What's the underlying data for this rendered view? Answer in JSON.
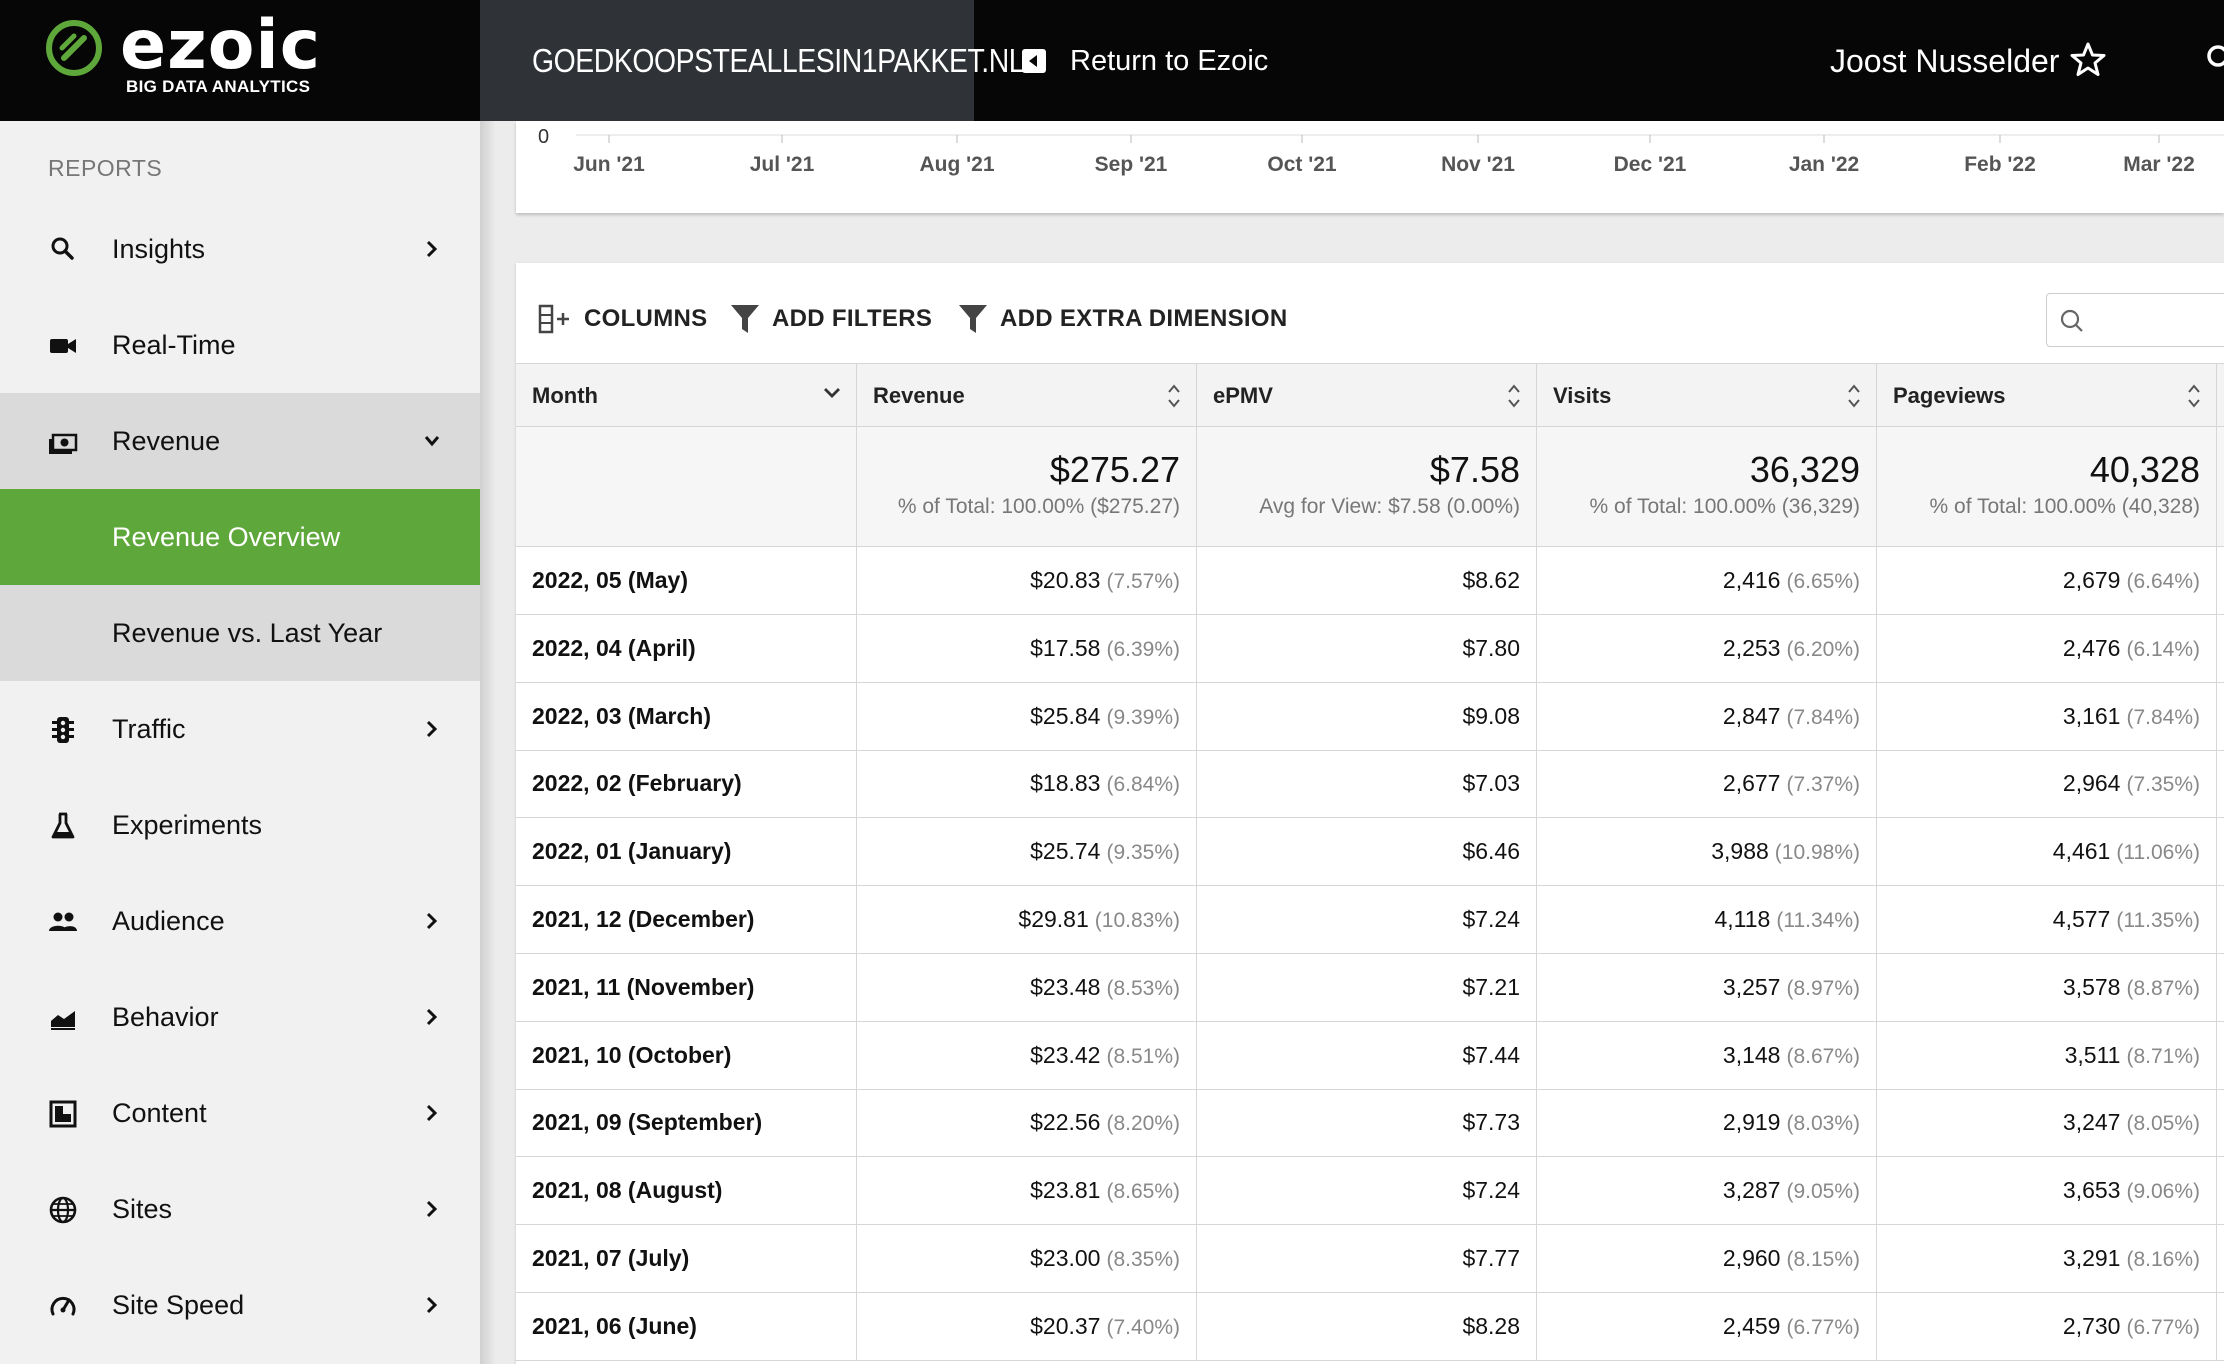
{
  "header": {
    "logo_text": "ezoic",
    "logo_sub": "BIG DATA ANALYTICS",
    "site_name": "GOEDKOOPSTEALLESIN1PAKKET.NL",
    "return_label": "Return to Ezoic",
    "user_name": "Joost Nusselder"
  },
  "sidebar": {
    "title": "REPORTS",
    "items": [
      {
        "label": "Insights",
        "icon": "search-icon"
      },
      {
        "label": "Real-Time",
        "icon": "video-camera-icon"
      },
      {
        "label": "Revenue",
        "icon": "money-icon"
      },
      {
        "label": "Revenue Overview"
      },
      {
        "label": "Revenue vs. Last Year"
      },
      {
        "label": "Traffic",
        "icon": "traffic-light-icon"
      },
      {
        "label": "Experiments",
        "icon": "flask-icon"
      },
      {
        "label": "Audience",
        "icon": "people-icon"
      },
      {
        "label": "Behavior",
        "icon": "area-chart-icon"
      },
      {
        "label": "Content",
        "icon": "content-layout-icon"
      },
      {
        "label": "Sites",
        "icon": "globe-icon"
      },
      {
        "label": "Site Speed",
        "icon": "speedometer-icon"
      }
    ]
  },
  "chart": {
    "y_zero": "0",
    "x_labels": [
      "Jun '21",
      "Jul '21",
      "Aug '21",
      "Sep '21",
      "Oct '21",
      "Nov '21",
      "Dec '21",
      "Jan '22",
      "Feb '22",
      "Mar '22"
    ]
  },
  "toolbar": {
    "columns_label": "COLUMNS",
    "filters_label": "ADD FILTERS",
    "dimension_label": "ADD EXTRA DIMENSION"
  },
  "table": {
    "headers": [
      "Month",
      "Revenue",
      "ePMV",
      "Visits",
      "Pageviews"
    ],
    "totals": {
      "revenue": {
        "value": "$275.27",
        "note": "% of Total: 100.00%  ($275.27)"
      },
      "epmv": {
        "value": "$7.58",
        "note": "Avg for View: $7.58  (0.00%)"
      },
      "visits": {
        "value": "36,329",
        "note": "% of Total: 100.00%  (36,329)"
      },
      "pageviews": {
        "value": "40,328",
        "note": "% of Total: 100.00%  (40,328)"
      }
    },
    "rows": [
      {
        "month": "2022, 05 (May)",
        "revenue": "$20.83",
        "revenue_pct": "(7.57%)",
        "epmv": "$8.62",
        "visits": "2,416",
        "visits_pct": "(6.65%)",
        "pageviews": "2,679",
        "pageviews_pct": "(6.64%)"
      },
      {
        "month": "2022, 04 (April)",
        "revenue": "$17.58",
        "revenue_pct": "(6.39%)",
        "epmv": "$7.80",
        "visits": "2,253",
        "visits_pct": "(6.20%)",
        "pageviews": "2,476",
        "pageviews_pct": "(6.14%)"
      },
      {
        "month": "2022, 03 (March)",
        "revenue": "$25.84",
        "revenue_pct": "(9.39%)",
        "epmv": "$9.08",
        "visits": "2,847",
        "visits_pct": "(7.84%)",
        "pageviews": "3,161",
        "pageviews_pct": "(7.84%)"
      },
      {
        "month": "2022, 02 (February)",
        "revenue": "$18.83",
        "revenue_pct": "(6.84%)",
        "epmv": "$7.03",
        "visits": "2,677",
        "visits_pct": "(7.37%)",
        "pageviews": "2,964",
        "pageviews_pct": "(7.35%)"
      },
      {
        "month": "2022, 01 (January)",
        "revenue": "$25.74",
        "revenue_pct": "(9.35%)",
        "epmv": "$6.46",
        "visits": "3,988",
        "visits_pct": "(10.98%)",
        "pageviews": "4,461",
        "pageviews_pct": "(11.06%)"
      },
      {
        "month": "2021, 12 (December)",
        "revenue": "$29.81",
        "revenue_pct": "(10.83%)",
        "epmv": "$7.24",
        "visits": "4,118",
        "visits_pct": "(11.34%)",
        "pageviews": "4,577",
        "pageviews_pct": "(11.35%)"
      },
      {
        "month": "2021, 11 (November)",
        "revenue": "$23.48",
        "revenue_pct": "(8.53%)",
        "epmv": "$7.21",
        "visits": "3,257",
        "visits_pct": "(8.97%)",
        "pageviews": "3,578",
        "pageviews_pct": "(8.87%)"
      },
      {
        "month": "2021, 10 (October)",
        "revenue": "$23.42",
        "revenue_pct": "(8.51%)",
        "epmv": "$7.44",
        "visits": "3,148",
        "visits_pct": "(8.67%)",
        "pageviews": "3,511",
        "pageviews_pct": "(8.71%)"
      },
      {
        "month": "2021, 09 (September)",
        "revenue": "$22.56",
        "revenue_pct": "(8.20%)",
        "epmv": "$7.73",
        "visits": "2,919",
        "visits_pct": "(8.03%)",
        "pageviews": "3,247",
        "pageviews_pct": "(8.05%)"
      },
      {
        "month": "2021, 08 (August)",
        "revenue": "$23.81",
        "revenue_pct": "(8.65%)",
        "epmv": "$7.24",
        "visits": "3,287",
        "visits_pct": "(9.05%)",
        "pageviews": "3,653",
        "pageviews_pct": "(9.06%)"
      },
      {
        "month": "2021, 07 (July)",
        "revenue": "$23.00",
        "revenue_pct": "(8.35%)",
        "epmv": "$7.77",
        "visits": "2,960",
        "visits_pct": "(8.15%)",
        "pageviews": "3,291",
        "pageviews_pct": "(8.16%)"
      },
      {
        "month": "2021, 06 (June)",
        "revenue": "$20.37",
        "revenue_pct": "(7.40%)",
        "epmv": "$8.28",
        "visits": "2,459",
        "visits_pct": "(6.77%)",
        "pageviews": "2,730",
        "pageviews_pct": "(6.77%)"
      }
    ]
  },
  "colors": {
    "active_green": "#5ea73a",
    "topbar": "#060606",
    "site_tab": "#2f3338"
  }
}
